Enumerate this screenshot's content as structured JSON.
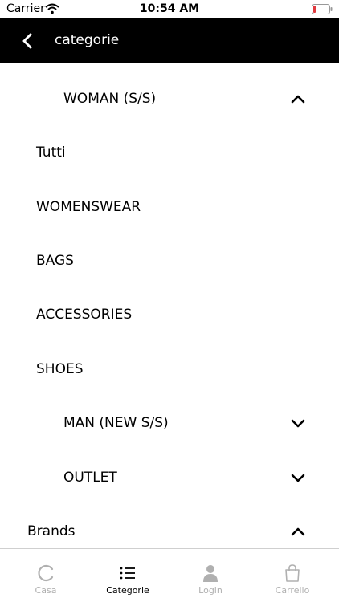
{
  "status_bar": {
    "carrier": "Carrier",
    "time": "10:54 AM",
    "wifi_icon": "wifi-icon",
    "battery_icon": "battery-low-icon",
    "battery_color": "#e0393e"
  },
  "header": {
    "title": "categorie",
    "back_icon": "chevron-left-icon",
    "background": "#000000"
  },
  "list": {
    "woman_label": "WOMAN (S/S)",
    "tutti_label": "Tutti",
    "womenswear_label": "WOMENSWEAR",
    "bags_label": "BAGS",
    "accessories_label": "ACCESSORIES",
    "shoes_label": "SHOES",
    "man_label": "MAN (NEW S/S)",
    "outlet_label": "OUTLET",
    "brands_label": "Brands"
  },
  "tab_bar": {
    "tabs": [
      {
        "label": "Casa",
        "icon": "refresh-icon",
        "active": false
      },
      {
        "label": "Categorie",
        "icon": "list-icon",
        "active": true
      },
      {
        "label": "Login",
        "icon": "user-icon",
        "active": false
      },
      {
        "label": "Carrello",
        "icon": "shopping-bag-icon",
        "active": false
      }
    ]
  }
}
